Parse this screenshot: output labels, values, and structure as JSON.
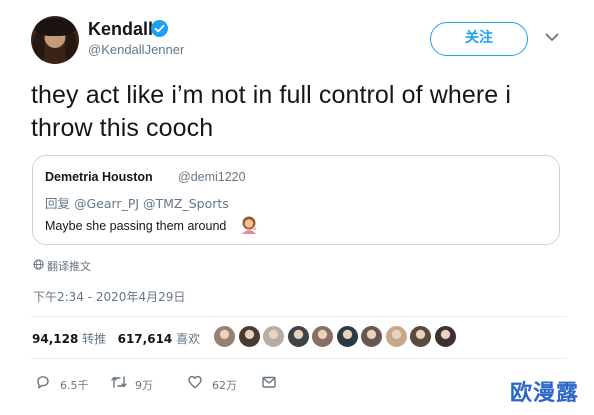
{
  "author": {
    "name": "Kendall",
    "handle": "@KendallJenner",
    "verified": true
  },
  "follow_label": "关注",
  "tweet_text": "they act like i’m not in full control of where i throw this cooch",
  "quoted": {
    "name": "Demetria Houston",
    "handle": "@demi1220",
    "reply_to": "回复 @Gearr_PJ @TMZ_Sports",
    "text": "Maybe she passing them around",
    "emoji": "woman-tipping-hand-emoji"
  },
  "translate_label": "翻译推文",
  "timestamp": "下午2:34 - 2020年4月29日",
  "stats": {
    "retweets": "94,128",
    "retweets_label": "转推",
    "likes": "617,614",
    "likes_label": "喜欢"
  },
  "likers": [
    "#9a8070",
    "#4a3a34",
    "#b8aca4",
    "#3f4448",
    "#8a6f60",
    "#2c3a46",
    "#6b5550",
    "#c7a98a",
    "#5c4a3c",
    "#3d3030"
  ],
  "actions": {
    "reply": "6.5千",
    "retweet": "9万",
    "like": "62万"
  },
  "watermark": "欧漫露",
  "colors": {
    "accent": "#1da1f2",
    "muted": "#657786",
    "text": "#14171a",
    "border": "#ccd6dd",
    "watermark": "#2b67c8"
  }
}
